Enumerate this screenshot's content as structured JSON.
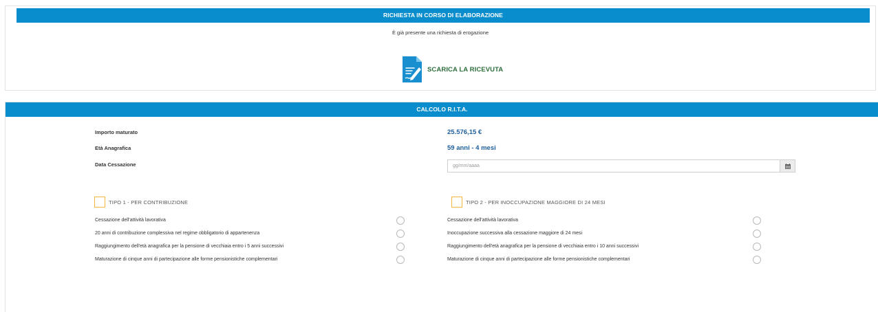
{
  "request_panel": {
    "title": "RICHIESTA IN CORSO DI ELABORAZIONE",
    "message": "È già presente una richiesta di erogazione",
    "download_label": "SCARICA LA RICEVUTA",
    "download_icon": "document-signature-icon"
  },
  "calc_panel": {
    "title": "CALCOLO R.I.T.A.",
    "fields": [
      {
        "label": "Importo maturato",
        "value": "25.576,15 €"
      },
      {
        "label": "Età Anagrafica",
        "value": "59 anni - 4 mesi"
      }
    ],
    "date_field": {
      "label": "Data Cessazione",
      "placeholder": "gg/mm/aaaa",
      "icon": "calendar-icon"
    },
    "tipo1": {
      "label": "TIPO 1 - PER CONTRIBUZIONE",
      "conditions": [
        "Cessazione dell'attività lavorativa",
        "20 anni di contribuzione complessiva nel regime obbligatorio di appartenenza",
        "Raggiungimento dell'età anagrafica per la pensione di vecchiaia entro i 5 anni successivi",
        "Maturazione di cinque anni di partecipazione alle forme pensionistiche complementari"
      ]
    },
    "tipo2": {
      "label": "TIPO 2 - PER INOCCUPAZIONE MAGGIORE DI 24 MESI",
      "conditions": [
        "Cessazione dell'attività lavorativa",
        "Inoccupazione successiva alla cessazione maggiore di 24 mesi",
        "Raggiungimento dell'età anagrafica per la pensione di vecchiaia entro i 10 anni successivi",
        "Maturazione di cinque anni di partecipazione alle forme pensionistiche complementari"
      ]
    }
  },
  "colors": {
    "header_blue": "#0a8dcc",
    "value_blue": "#1d5f9c",
    "download_green": "#2e6e3b",
    "checkbox_orange": "#f4b73b"
  }
}
